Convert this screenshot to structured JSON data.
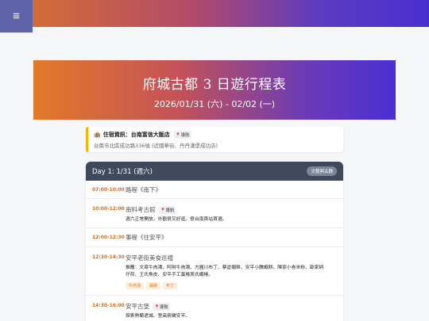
{
  "menu": {
    "icon": "≡"
  },
  "hero": {
    "title": "府城古都 3 日遊行程表",
    "date": "2026/01/31 (六) - 02/02 (一)"
  },
  "hotel": {
    "icon": "🏨",
    "label": "住宿資訊：台南富信大飯店",
    "nav_label": "導航",
    "address": "台南市北區成功路336號 (近國華街、丹丹漢堡成功店)"
  },
  "day1": {
    "title": "Day 1: 1/31 (週六)",
    "badge": "文藝與古蹟",
    "items": [
      {
        "time": "07:00-10:00",
        "name": "路程《南下》"
      },
      {
        "time": "10:00-12:00",
        "name": "南科考古館",
        "nav_label": "導航",
        "desc": "週六正常開放，外觀很又好逛，很台南首站首選。"
      },
      {
        "time": "12:00-12:30",
        "name": "事程《往安平》"
      },
      {
        "time": "12:30-14:30",
        "name": "安平老街美食巡禮",
        "desc_line1": "推薦：文章牛肉湯、阿財牛肉湯、方圓川布丁、蔡倉蝦餅、安平小騰蝦餅、陳家小卷米粉、歐家蚵",
        "desc_line2": "仔煎、王氏魚皮、安平手工蛋捲周氏蝦捲。",
        "tags": [
          "牛肉湯",
          "蝦捲",
          "布丁"
        ]
      },
      {
        "time": "14:30-16:00",
        "name": "安平古堡",
        "nav_label": "導航",
        "desc": "探索熱蘭遮城、登高俯瞰安平。"
      }
    ]
  },
  "colors": {
    "accent_time": "#e06b1a",
    "day_header": "#3e4a5c",
    "hotel_border": "#f2b705"
  }
}
